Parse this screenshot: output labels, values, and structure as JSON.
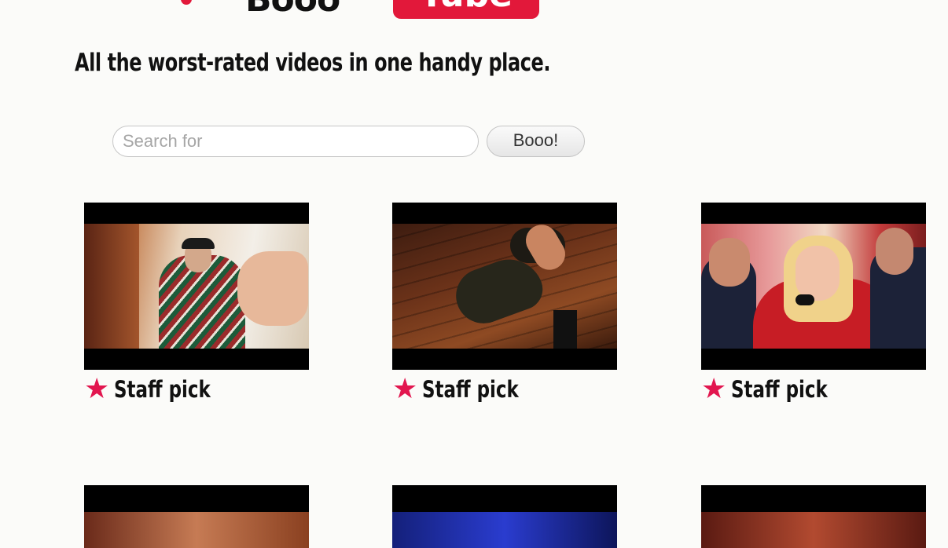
{
  "logo": {
    "left_text": "Booo",
    "right_text": "Tube"
  },
  "tagline": "All the worst-rated videos in one handy place.",
  "search": {
    "placeholder": "Search for",
    "value": "",
    "button_label": "Booo!"
  },
  "videos": [
    {
      "badge": "Staff pick"
    },
    {
      "badge": "Staff pick"
    },
    {
      "badge": "Staff pick"
    }
  ],
  "icons": {
    "badge_icon": "star-icon",
    "badge_color": "#e2164f",
    "brand_color": "#e2183a"
  }
}
